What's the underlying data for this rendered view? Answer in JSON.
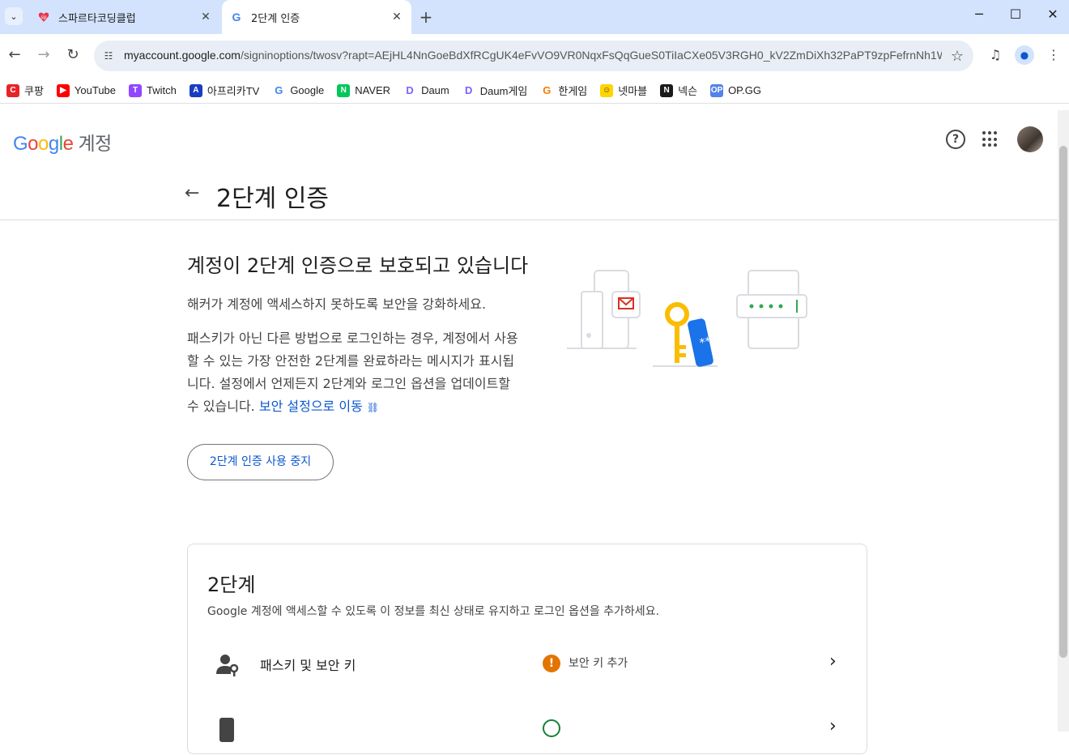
{
  "browser": {
    "tabs": [
      {
        "title": "스파르타코딩클럽",
        "active": false
      },
      {
        "title": "2단계 인증",
        "active": true
      }
    ],
    "url_host": "myaccount.google.com",
    "url_path": "/signinoptions/twosv?rapt=AEjHL4NnGoeBdXfRCgUK4eFvVO9VR0NqxFsQqGueS0TiIaCXe05V3RGH0_kV2ZmDiXh32PaPT9zpFefrnNh1W...",
    "bookmarks": [
      {
        "label": "쿠팡",
        "icon": "coupang-icon",
        "color": "#e52528",
        "glyph": "C"
      },
      {
        "label": "YouTube",
        "icon": "youtube-icon",
        "color": "#ff0000",
        "glyph": "▶"
      },
      {
        "label": "Twitch",
        "icon": "twitch-icon",
        "color": "#9146ff",
        "glyph": "T"
      },
      {
        "label": "아프리카TV",
        "icon": "afreecatv-icon",
        "color": "#1a3dbf",
        "glyph": "A"
      },
      {
        "label": "Google",
        "icon": "google-icon",
        "color": "#ffffff",
        "glyph": "G"
      },
      {
        "label": "NAVER",
        "icon": "naver-icon",
        "color": "#03c75a",
        "glyph": "N"
      },
      {
        "label": "Daum",
        "icon": "daum-icon",
        "color": "#ffffff",
        "glyph": "D"
      },
      {
        "label": "Daum게임",
        "icon": "daum-game-icon",
        "color": "#ffffff",
        "glyph": "D"
      },
      {
        "label": "한게임",
        "icon": "hangame-icon",
        "color": "#ffffff",
        "glyph": "G"
      },
      {
        "label": "넷마블",
        "icon": "netmarble-icon",
        "color": "#ffd400",
        "glyph": "☺"
      },
      {
        "label": "넥슨",
        "icon": "nexon-icon",
        "color": "#1a1a1a",
        "glyph": "N"
      },
      {
        "label": "OP.GG",
        "icon": "opgg-icon",
        "color": "#5383e8",
        "glyph": "OP"
      }
    ]
  },
  "header": {
    "logo_google": "Google",
    "logo_account": "계정"
  },
  "page": {
    "title": "2단계 인증",
    "hero_heading": "계정이 2단계 인증으로 보호되고 있습니다",
    "hero_subtitle": "해커가 계정에 액세스하지 못하도록 보안을 강화하세요.",
    "hero_body": "패스키가 아닌 다른 방법으로 로그인하는 경우, 계정에서 사용할 수 있는 가장 안전한 2단계를 완료하라는 메시지가 표시됩니다. 설정에서 언제든지 2단계와 로그인 옵션을 업데이트할 수 있습니다.",
    "hero_link": "보안 설정으로 이동",
    "stop_button": "2단계 인증 사용 중지",
    "card_title": "2단계",
    "card_subtitle": "Google 계정에 액세스할 수 있도록 이 정보를 최신 상태로 유지하고 로그인 옵션을 추가하세요.",
    "rows": [
      {
        "label": "패스키 및 보안 키",
        "status": "보안 키 추가",
        "status_color": "#e37400"
      }
    ]
  }
}
